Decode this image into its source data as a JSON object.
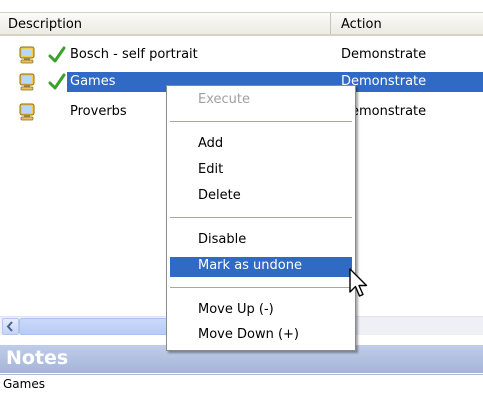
{
  "list": {
    "columns": {
      "description": "Description",
      "action": "Action"
    },
    "rows": [
      {
        "description": "Bosch - self portrait",
        "action": "Demonstrate",
        "checked": true,
        "selected": false
      },
      {
        "description": "Games",
        "action": "Demonstrate",
        "checked": true,
        "selected": true
      },
      {
        "description": "Proverbs",
        "action": "Demonstrate",
        "checked": false,
        "selected": false
      }
    ]
  },
  "context_menu": {
    "execute": "Execute",
    "add": "Add",
    "edit": "Edit",
    "delete": "Delete",
    "disable": "Disable",
    "mark_as_undone": "Mark as undone",
    "move_up": "Move Up (-)",
    "move_down": "Move Down (+)",
    "highlighted": "Mark as undone"
  },
  "notes": {
    "title": "Notes",
    "text": "Games"
  },
  "colors": {
    "selection": "#316ac5",
    "notes_header": "#b3c2e2",
    "check": "#3aa12b"
  },
  "icons": {
    "row_icon": "computer-icon",
    "status_icon": "checkmark-icon",
    "scroll_left": "arrow-left-icon",
    "pointer": "mouse-cursor-icon"
  }
}
